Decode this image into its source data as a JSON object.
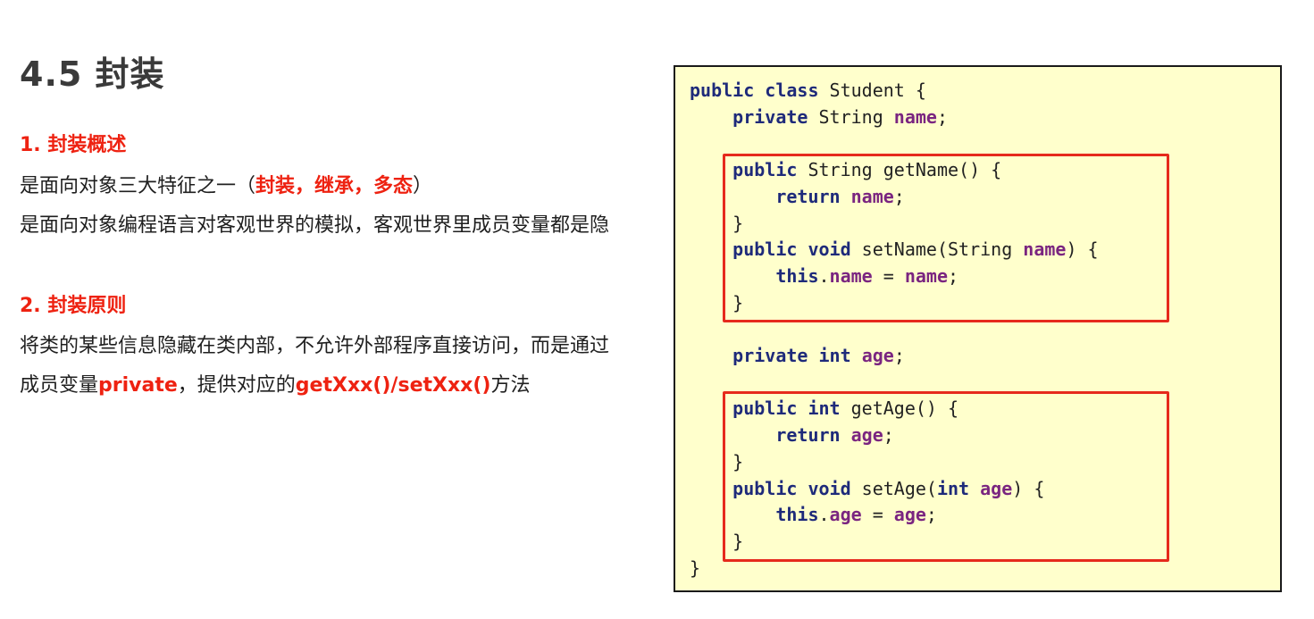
{
  "slide": {
    "title": "4.5 封装",
    "section1": {
      "heading": "1. 封装概述",
      "line1_prefix": "是面向对象三大特征之一（",
      "line1_emphasis": "封装，继承，多态",
      "line1_suffix": "）",
      "line2": "是面向对象编程语言对客观世界的模拟，客观世界里成员变量都是隐"
    },
    "section2": {
      "heading": "2. 封装原则",
      "line1": "将类的某些信息隐藏在类内部，不允许外部程序直接访问，而是通过",
      "line2_prefix": "成员变量",
      "line2_emph1": "private",
      "line2_mid": "，提供对应的",
      "line2_emph2": "getXxx()/setXxx()",
      "line2_suffix": "方法"
    }
  },
  "code": {
    "lines": [
      [
        [
          "kw",
          "public"
        ],
        [
          "t",
          " "
        ],
        [
          "kw",
          "class"
        ],
        [
          "t",
          " Student {"
        ]
      ],
      [
        [
          "t",
          "    "
        ],
        [
          "kw",
          "private"
        ],
        [
          "t",
          " String "
        ],
        [
          "fd",
          "name"
        ],
        [
          "t",
          ";"
        ]
      ],
      [],
      [
        [
          "t",
          "    "
        ],
        [
          "kw",
          "public"
        ],
        [
          "t",
          " String getName() {"
        ]
      ],
      [
        [
          "t",
          "        "
        ],
        [
          "kw",
          "return"
        ],
        [
          "t",
          " "
        ],
        [
          "fd",
          "name"
        ],
        [
          "t",
          ";"
        ]
      ],
      [
        [
          "t",
          "    }"
        ]
      ],
      [
        [
          "t",
          "    "
        ],
        [
          "kw",
          "public"
        ],
        [
          "t",
          " "
        ],
        [
          "kw",
          "void"
        ],
        [
          "t",
          " setName(String "
        ],
        [
          "fd",
          "name"
        ],
        [
          "t",
          ") {"
        ]
      ],
      [
        [
          "t",
          "        "
        ],
        [
          "kw",
          "this"
        ],
        [
          "t",
          "."
        ],
        [
          "fd",
          "name"
        ],
        [
          "t",
          " = "
        ],
        [
          "fd",
          "name"
        ],
        [
          "t",
          ";"
        ]
      ],
      [
        [
          "t",
          "    }"
        ]
      ],
      [],
      [
        [
          "t",
          "    "
        ],
        [
          "kw",
          "private"
        ],
        [
          "t",
          " "
        ],
        [
          "kw",
          "int"
        ],
        [
          "t",
          " "
        ],
        [
          "fd",
          "age"
        ],
        [
          "t",
          ";"
        ]
      ],
      [],
      [
        [
          "t",
          "    "
        ],
        [
          "kw",
          "public"
        ],
        [
          "t",
          " "
        ],
        [
          "kw",
          "int"
        ],
        [
          "t",
          " getAge() {"
        ]
      ],
      [
        [
          "t",
          "        "
        ],
        [
          "kw",
          "return"
        ],
        [
          "t",
          " "
        ],
        [
          "fd",
          "age"
        ],
        [
          "t",
          ";"
        ]
      ],
      [
        [
          "t",
          "    }"
        ]
      ],
      [
        [
          "t",
          "    "
        ],
        [
          "kw",
          "public"
        ],
        [
          "t",
          " "
        ],
        [
          "kw",
          "void"
        ],
        [
          "t",
          " setAge("
        ],
        [
          "kw",
          "int"
        ],
        [
          "t",
          " "
        ],
        [
          "fd",
          "age"
        ],
        [
          "t",
          ") {"
        ]
      ],
      [
        [
          "t",
          "        "
        ],
        [
          "kw",
          "this"
        ],
        [
          "t",
          "."
        ],
        [
          "fd",
          "age"
        ],
        [
          "t",
          " = "
        ],
        [
          "fd",
          "age"
        ],
        [
          "t",
          ";"
        ]
      ],
      [
        [
          "t",
          "    }"
        ]
      ],
      [
        [
          "t",
          "}"
        ]
      ]
    ]
  },
  "colors": {
    "heading_red": "#ee2211",
    "keyword_navy": "#1e2a7a",
    "field_purple": "#7a2580",
    "code_background": "#ffffcc",
    "highlight_border": "#e62a1c"
  }
}
